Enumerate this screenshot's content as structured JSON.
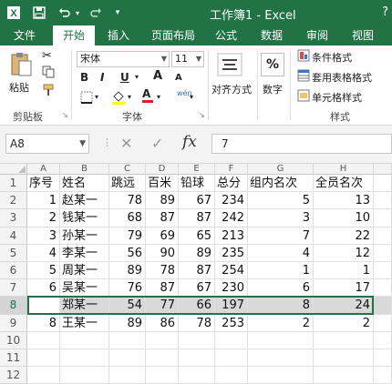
{
  "window": {
    "title": "工作簿1 - Excel",
    "help": "?"
  },
  "qat": {
    "save_icon": "save-icon",
    "undo_icon": "undo-icon",
    "redo_icon": "redo-icon"
  },
  "tabs": [
    {
      "label": "文件"
    },
    {
      "label": "开始"
    },
    {
      "label": "插入"
    },
    {
      "label": "页面布局"
    },
    {
      "label": "公式"
    },
    {
      "label": "数据"
    },
    {
      "label": "审阅"
    },
    {
      "label": "视图"
    }
  ],
  "ribbon": {
    "clipboard": {
      "paste": "粘贴",
      "group": "剪贴板"
    },
    "font": {
      "name": "宋体",
      "size": "11",
      "group": "字体",
      "bold": "B",
      "italic": "I",
      "underline": "U",
      "grow": "A",
      "shrink": "A",
      "font_color": "A",
      "wen": "wén"
    },
    "alignment": {
      "label": "对齐方式"
    },
    "number": {
      "label": "数字",
      "symbol": "%"
    },
    "styles": {
      "cond": "条件格式",
      "table": "套用表格格式",
      "cell": "单元格样式",
      "group": "样式"
    }
  },
  "formula_bar": {
    "name_box": "A8",
    "value": "7",
    "fx": "fx",
    "cancel": "✕",
    "enter": "✓"
  },
  "grid": {
    "columns": [
      "A",
      "B",
      "C",
      "D",
      "E",
      "F",
      "G",
      "H"
    ],
    "rows": [
      "1",
      "2",
      "3",
      "4",
      "5",
      "6",
      "7",
      "8",
      "9",
      "10",
      "11",
      "12"
    ],
    "header": [
      "序号",
      "姓名",
      "跳远",
      "百米",
      "铅球",
      "总分",
      "组内名次",
      "全员名次"
    ],
    "data": [
      [
        "1",
        "赵某一",
        "78",
        "89",
        "67",
        "234",
        "5",
        "13"
      ],
      [
        "2",
        "钱某一",
        "68",
        "87",
        "87",
        "242",
        "3",
        "10"
      ],
      [
        "3",
        "孙某一",
        "79",
        "69",
        "65",
        "213",
        "7",
        "22"
      ],
      [
        "4",
        "李某一",
        "56",
        "90",
        "89",
        "235",
        "4",
        "12"
      ],
      [
        "5",
        "周某一",
        "89",
        "78",
        "87",
        "254",
        "1",
        "1"
      ],
      [
        "6",
        "吴某一",
        "76",
        "87",
        "67",
        "230",
        "6",
        "17"
      ],
      [
        "7",
        "郑某一",
        "54",
        "77",
        "66",
        "197",
        "8",
        "24"
      ],
      [
        "8",
        "王某一",
        "89",
        "86",
        "78",
        "253",
        "2",
        "2"
      ]
    ],
    "selected_row": "8"
  }
}
